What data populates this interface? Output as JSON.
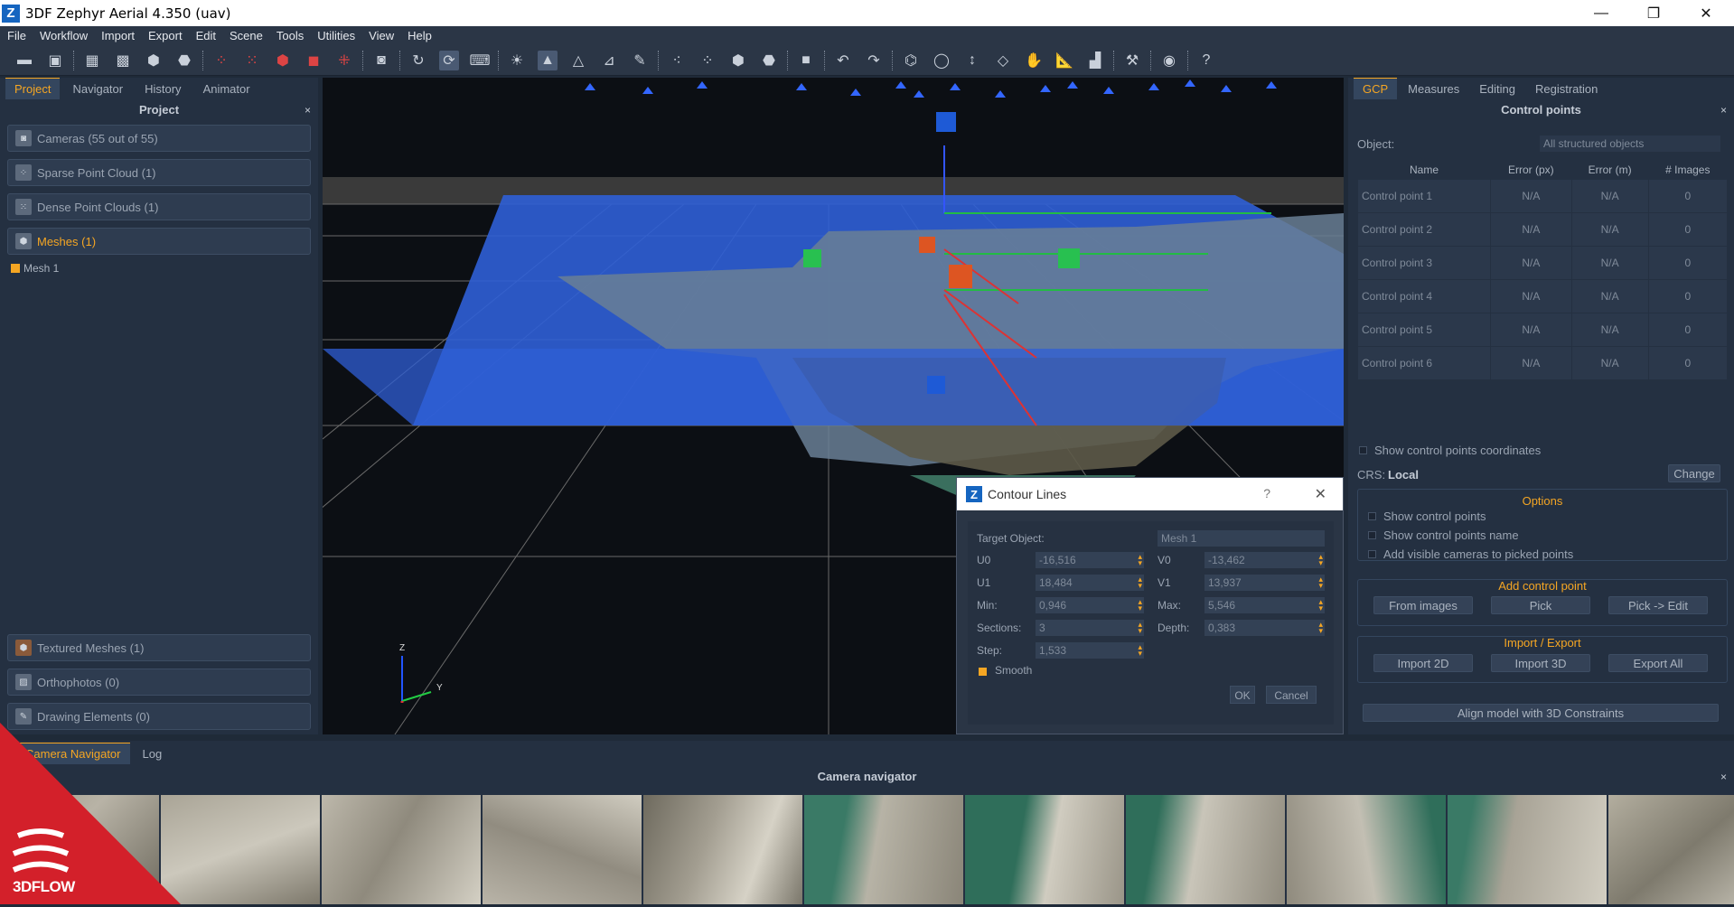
{
  "window": {
    "title": "3DF Zephyr Aerial 4.350 (uav)",
    "logo": "Z",
    "minimize": "—",
    "restore": "❐",
    "close": "✕"
  },
  "menu": [
    "File",
    "Workflow",
    "Import",
    "Export",
    "Edit",
    "Scene",
    "Tools",
    "Utilities",
    "View",
    "Help"
  ],
  "left_panel": {
    "tabs": [
      "Project",
      "Navigator",
      "History",
      "Animator"
    ],
    "header": "Project",
    "close": "×",
    "items": [
      {
        "label": "Cameras (55 out of 55)",
        "icon": "camera-icon"
      },
      {
        "label": "Sparse Point Cloud (1)",
        "icon": "sparse-cloud-icon"
      },
      {
        "label": "Dense Point Clouds (1)",
        "icon": "dense-cloud-icon"
      },
      {
        "label": "Meshes (1)",
        "icon": "mesh-icon"
      }
    ],
    "mesh_child": "Mesh 1",
    "bottom_items": [
      {
        "label": "Textured Meshes (1)",
        "icon": "textured-mesh-icon"
      },
      {
        "label": "Orthophotos (0)",
        "icon": "orthophoto-icon"
      },
      {
        "label": "Drawing Elements (0)",
        "icon": "drawing-icon"
      }
    ]
  },
  "viewport": {
    "axis_z": "Z",
    "axis_y": "Y"
  },
  "dialog": {
    "title": "Contour Lines",
    "help": "?",
    "close": "✕",
    "target_label": "Target Object:",
    "target_value": "Mesh 1",
    "u0_label": "U0",
    "u0": "-16,516",
    "v0_label": "V0",
    "v0": "-13,462",
    "u1_label": "U1",
    "u1": "18,484",
    "v1_label": "V1",
    "v1": "13,937",
    "min_label": "Min:",
    "min": "0,946",
    "max_label": "Max:",
    "max": "5,546",
    "sections_label": "Sections:",
    "sections": "3",
    "depth_label": "Depth:",
    "depth": "0,383",
    "step_label": "Step:",
    "step": "1,533",
    "smooth": "Smooth",
    "ok": "OK",
    "cancel": "Cancel"
  },
  "right_panel": {
    "tabs": [
      "GCP",
      "Measures",
      "Editing",
      "Registration"
    ],
    "header": "Control points",
    "close": "×",
    "object_label": "Object:",
    "object_value": "All structured objects",
    "columns": [
      "Name",
      "Error (px)",
      "Error (m)",
      "# Images"
    ],
    "rows": [
      [
        "Control point 1",
        "N/A",
        "N/A",
        "0"
      ],
      [
        "Control point 2",
        "N/A",
        "N/A",
        "0"
      ],
      [
        "Control point 3",
        "N/A",
        "N/A",
        "0"
      ],
      [
        "Control point 4",
        "N/A",
        "N/A",
        "0"
      ],
      [
        "Control point 5",
        "N/A",
        "N/A",
        "0"
      ],
      [
        "Control point 6",
        "N/A",
        "N/A",
        "0"
      ]
    ],
    "show_coords": "Show control points coordinates",
    "crs_label": "CRS:",
    "crs_value": "Local",
    "change": "Change",
    "options_title": "Options",
    "opt1": "Show control points",
    "opt2": "Show control points name",
    "opt3": "Add visible cameras to picked points",
    "add_title": "Add control point",
    "from_images": "From images",
    "pick": "Pick",
    "pick_edit": "Pick -> Edit",
    "ie_title": "Import / Export",
    "import2d": "Import 2D",
    "import3d": "Import 3D",
    "export_all": "Export All",
    "align": "Align model with 3D Constraints"
  },
  "bottom": {
    "tabs": [
      "Camera Navigator",
      "Log"
    ],
    "header": "Camera navigator",
    "close": "×",
    "brand": "3DFLOW"
  },
  "colors": {
    "accent": "#f5a623",
    "panel": "#243041",
    "plane": "#2f5fd6"
  }
}
